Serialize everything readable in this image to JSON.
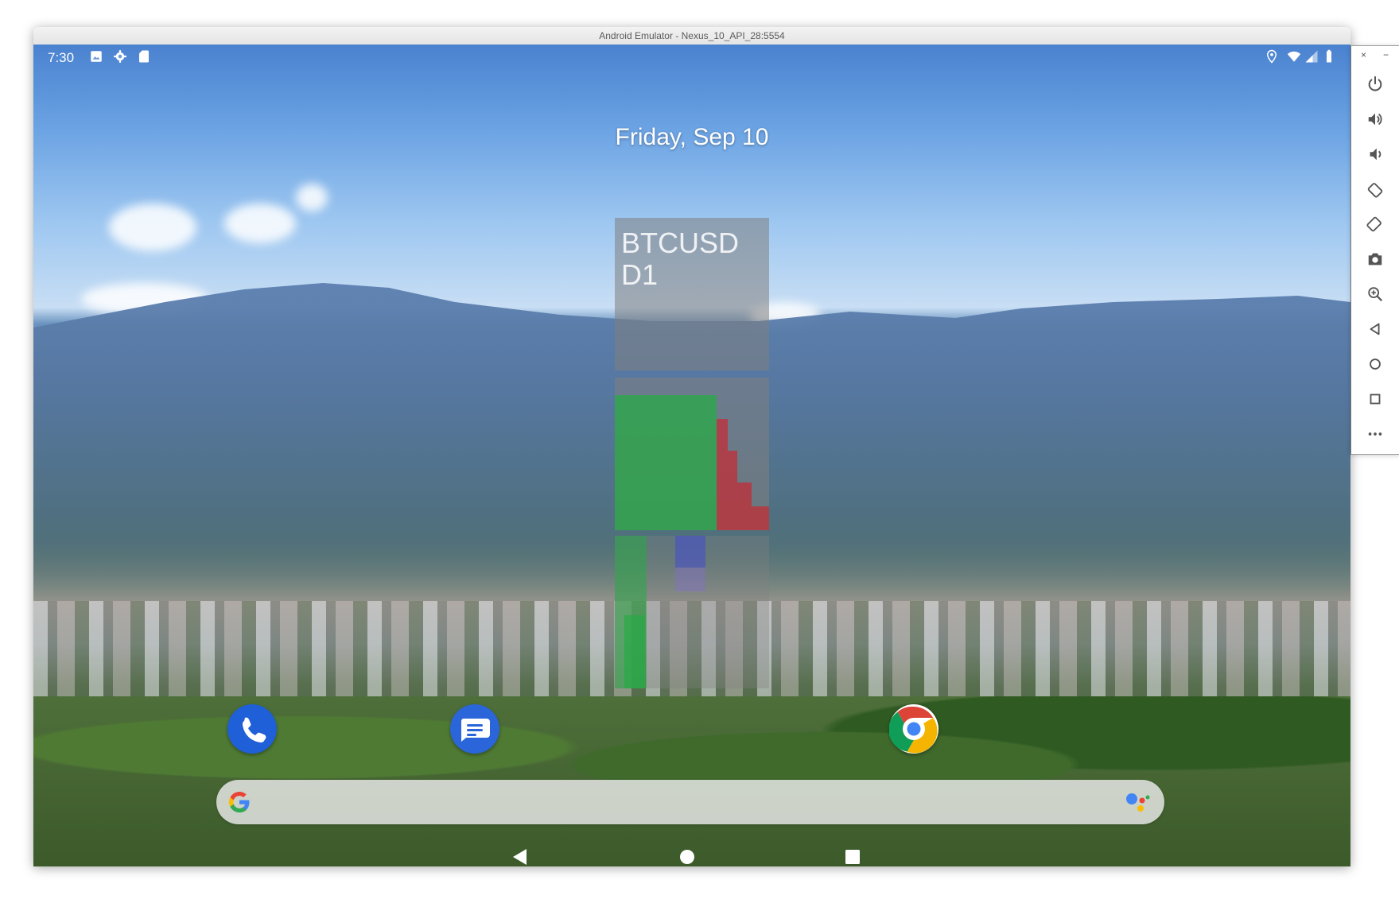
{
  "window": {
    "title": "Android Emulator - Nexus_10_API_28:5554"
  },
  "status_bar": {
    "time": "7:30",
    "left_icons": [
      "image-icon",
      "gear-icon",
      "sd-card-icon"
    ],
    "right_icons": [
      "location-icon",
      "wifi-icon",
      "signal-icon",
      "battery-icon"
    ]
  },
  "home": {
    "date": "Friday, Sep 10",
    "widget": {
      "symbol": "BTCUSD",
      "timeframe": "D1",
      "colors": {
        "up": "#28aa46",
        "down": "#c82832",
        "neutral": "#4650c8"
      }
    },
    "dock_apps": [
      {
        "name": "Phone",
        "icon": "phone-icon",
        "color": "#1f5fd8"
      },
      {
        "name": "Messages",
        "icon": "messages-icon",
        "color": "#2a66d9"
      },
      {
        "name": "Chrome",
        "icon": "chrome-icon",
        "color": "#ffffff"
      }
    ],
    "search": {
      "left_icon": "google-g-icon",
      "right_icon": "google-assistant-icon"
    }
  },
  "nav_bar": {
    "buttons": [
      "back-icon",
      "home-icon",
      "recents-icon"
    ]
  },
  "emulator_toolbar": {
    "buttons": [
      {
        "name": "power",
        "icon": "power-icon"
      },
      {
        "name": "volume-up",
        "icon": "volume-up-icon"
      },
      {
        "name": "volume-down",
        "icon": "volume-down-icon"
      },
      {
        "name": "rotate-left",
        "icon": "rotate-left-icon"
      },
      {
        "name": "rotate-right",
        "icon": "rotate-right-icon"
      },
      {
        "name": "screenshot",
        "icon": "camera-icon"
      },
      {
        "name": "zoom",
        "icon": "zoom-icon"
      },
      {
        "name": "back",
        "icon": "back-icon"
      },
      {
        "name": "home",
        "icon": "home-icon"
      },
      {
        "name": "overview",
        "icon": "overview-icon"
      },
      {
        "name": "more",
        "icon": "more-icon"
      }
    ],
    "close_glyph": "×",
    "minimize_glyph": "−"
  }
}
